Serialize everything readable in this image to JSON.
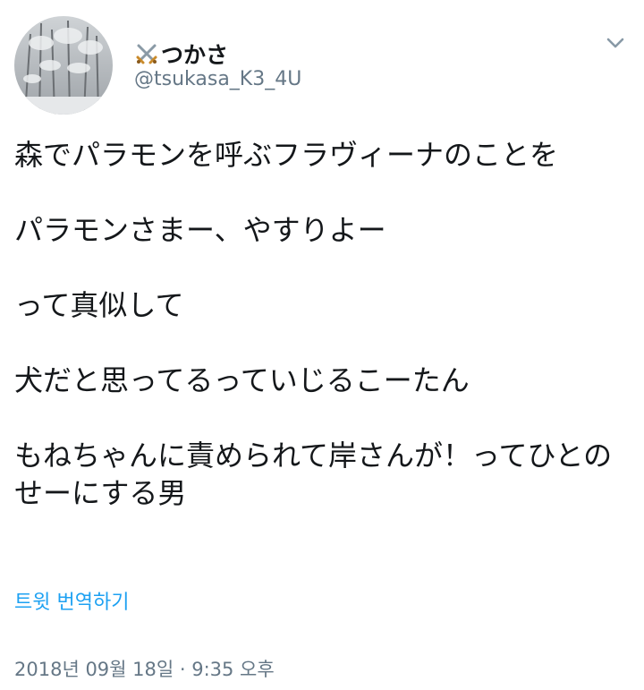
{
  "tweet": {
    "display_name": "つかさ",
    "name_icon": "crossed-swords-icon",
    "handle": "@tsukasa_K3_4U",
    "avatar_icon": "snowy-forest-avatar",
    "menu_icon": "chevron-down-icon",
    "paragraphs": [
      "森でパラモンを呼ぶフラヴィーナのことを",
      "パラモンさまー、やすりよー",
      "って真似して",
      "犬だと思ってるっていじるこーたん",
      "もねちゃんに責められて岸さんが！ってひとのせーにする男"
    ],
    "translate_label": "트윗 번역하기",
    "timestamp": "2018년 09월 18일 · 9:35 오후"
  },
  "colors": {
    "text": "#14171a",
    "secondary": "#657786",
    "link": "#1da1f2",
    "background": "#ffffff"
  }
}
